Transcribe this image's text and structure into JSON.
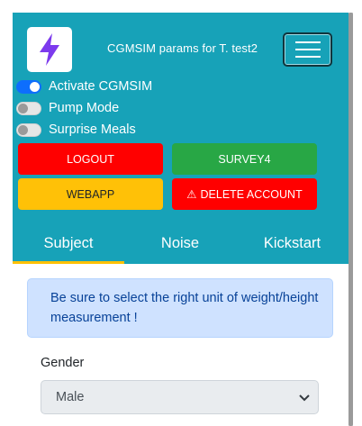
{
  "app": {
    "title": "CGMSIM params for T. test2",
    "logo_icon": "lightning-bolt-icon",
    "brand_color": "#17a2b8"
  },
  "toggles": [
    {
      "label": "Activate CGMSIM",
      "checked": true
    },
    {
      "label": "Pump Mode",
      "checked": false
    },
    {
      "label": "Surprise Meals",
      "checked": false
    }
  ],
  "buttons": {
    "logout": "LOGOUT",
    "survey": "SURVEY4",
    "webapp": "WEBAPP",
    "delete_icon": "⚠",
    "delete_label": "DELETE ACCOUNT"
  },
  "tabs": [
    {
      "label": "Subject",
      "active": true
    },
    {
      "label": "Noise",
      "active": false
    },
    {
      "label": "Kickstart",
      "active": false
    }
  ],
  "alert": {
    "text": "Be sure to select the right unit of weight/height measurement !"
  },
  "gender": {
    "label": "Gender",
    "selected": "Male"
  }
}
